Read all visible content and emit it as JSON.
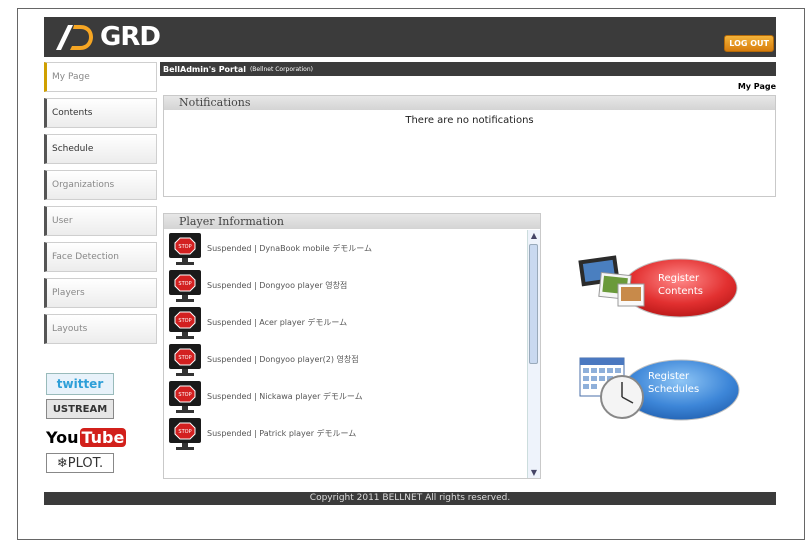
{
  "header": {
    "logo_text": "GRD",
    "logout_label": "LOG OUT"
  },
  "sidebar": {
    "items": [
      {
        "label": "My Page"
      },
      {
        "label": "Contents"
      },
      {
        "label": "Schedule"
      },
      {
        "label": "Organizations"
      },
      {
        "label": "User"
      },
      {
        "label": "Face Detection"
      },
      {
        "label": "Players"
      },
      {
        "label": "Layouts"
      }
    ]
  },
  "social": {
    "twitter": "twitter",
    "ustream": "USTREAM",
    "youtube_you": "You",
    "youtube_tube": "Tube",
    "plot": "❄PLOT."
  },
  "portal": {
    "title": "BellAdmin's Portal",
    "company": "(Bellnet Corporation)",
    "breadcrumb": "My Page"
  },
  "notifications": {
    "heading": "Notifications",
    "empty_text": "There are no notifications"
  },
  "player_info": {
    "heading": "Player Information",
    "rows": [
      {
        "text": "Suspended | DynaBook mobile  デモルーム"
      },
      {
        "text": "Suspended | Dongyoo player    영창점"
      },
      {
        "text": "Suspended | Acer player          デモルーム"
      },
      {
        "text": "Suspended | Dongyoo player(2) 영창점"
      },
      {
        "text": "Suspended | Nickawa player    デモルーム"
      },
      {
        "text": "Suspended | Patrick player      デモルーム"
      }
    ]
  },
  "actions": {
    "register_contents": {
      "line1": "Register",
      "line2": "Contents"
    },
    "register_schedules": {
      "line1": "Register",
      "line2": "Schedules"
    }
  },
  "footer": {
    "copyright": "Copyright 2011  BELLNET All rights reserved."
  }
}
